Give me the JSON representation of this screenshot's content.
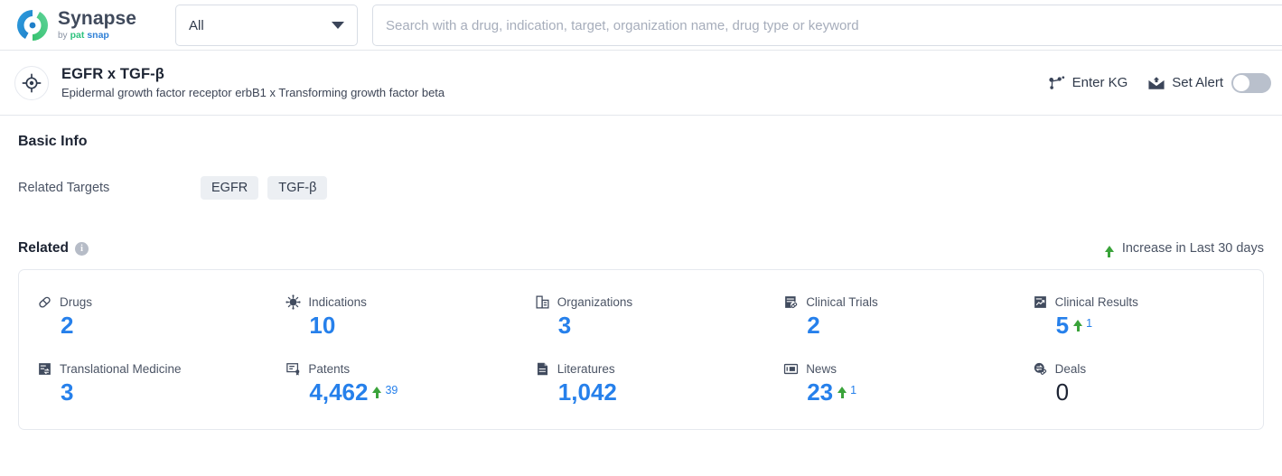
{
  "topbar": {
    "brand": {
      "name": "Synapse",
      "by": "by",
      "pat": "pat",
      "snap": "snap"
    },
    "category_select": {
      "value": "All",
      "icon": "chevron-down-icon"
    },
    "search": {
      "value": "",
      "placeholder": "Search with a drug, indication, target, organization name, drug type or keyword"
    }
  },
  "entity": {
    "icon": "target-icon",
    "name": "EGFR x TGF-β",
    "description": "Epidermal growth factor receptor erbB1 x Transforming growth factor beta",
    "actions": {
      "enter_kg": {
        "label": "Enter KG",
        "icon": "knowledge-graph-icon"
      },
      "set_alert": {
        "label": "Set Alert",
        "icon": "mail-alert-icon",
        "toggle_on": false
      }
    }
  },
  "basic_info": {
    "title": "Basic Info",
    "related_targets_label": "Related Targets",
    "related_targets": [
      "EGFR",
      "TGF-β"
    ]
  },
  "related": {
    "title": "Related",
    "info_icon_char": "i",
    "legend": {
      "text": "Increase in Last 30 days",
      "icon": "arrow-up-icon",
      "color": "#3aa33a"
    },
    "accent_color": "#2680eb",
    "stats": [
      {
        "label": "Drugs",
        "icon": "pill-icon",
        "value": "2",
        "delta": null,
        "is_zero": false
      },
      {
        "label": "Indications",
        "icon": "virus-icon",
        "value": "10",
        "delta": null,
        "is_zero": false
      },
      {
        "label": "Organizations",
        "icon": "building-icon",
        "value": "3",
        "delta": null,
        "is_zero": false
      },
      {
        "label": "Clinical Trials",
        "icon": "trial-document-icon",
        "value": "2",
        "delta": null,
        "is_zero": false
      },
      {
        "label": "Clinical Results",
        "icon": "results-chart-icon",
        "value": "5",
        "delta": "1",
        "is_zero": false
      },
      {
        "label": "Translational Medicine",
        "icon": "translational-icon",
        "value": "3",
        "delta": null,
        "is_zero": false
      },
      {
        "label": "Patents",
        "icon": "patent-icon",
        "value": "4,462",
        "delta": "39",
        "is_zero": false
      },
      {
        "label": "Literatures",
        "icon": "literature-icon",
        "value": "1,042",
        "delta": null,
        "is_zero": false
      },
      {
        "label": "News",
        "icon": "news-icon",
        "value": "23",
        "delta": "1",
        "is_zero": false
      },
      {
        "label": "Deals",
        "icon": "deals-icon",
        "value": "0",
        "delta": null,
        "is_zero": true
      }
    ]
  }
}
